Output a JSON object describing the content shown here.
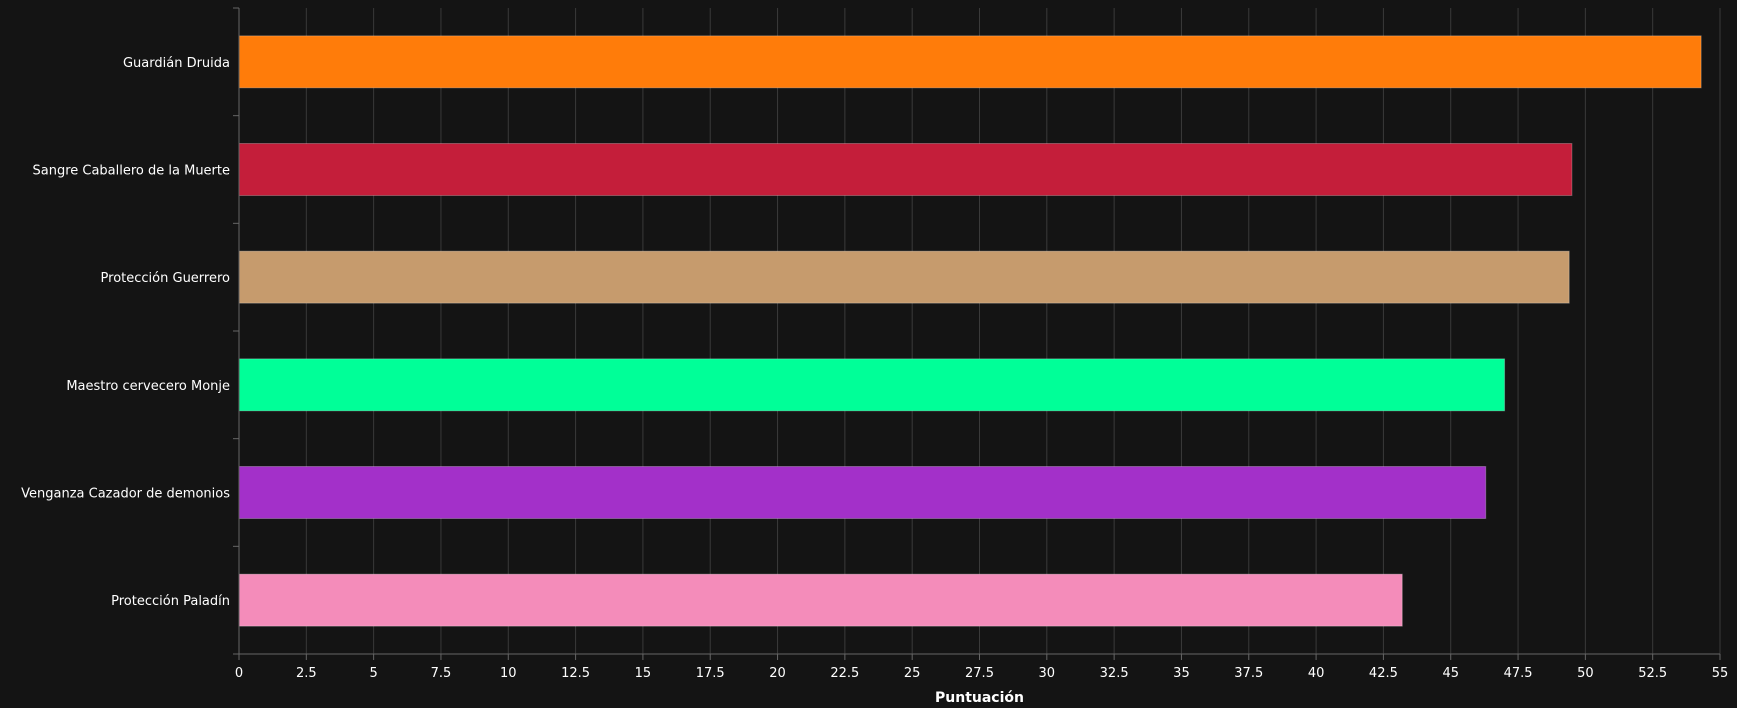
{
  "chart_data": {
    "type": "bar",
    "orientation": "horizontal",
    "categories": [
      "Guardián Druida",
      "Sangre Caballero de la Muerte",
      "Protección Guerrero",
      "Maestro cervecero Monje",
      "Venganza Cazador de demonios",
      "Protección Paladín"
    ],
    "values": [
      54.3,
      49.5,
      49.4,
      47.0,
      46.3,
      43.2
    ],
    "colors": [
      "#FF7C0A",
      "#C41E3A",
      "#C69B6D",
      "#00FF98",
      "#A330C9",
      "#F48CBA"
    ],
    "xlabel": "Puntuación",
    "ylabel": "",
    "xlim": [
      0,
      55
    ],
    "xticks": [
      "0",
      "2.5",
      "5",
      "7.5",
      "10",
      "12.5",
      "15",
      "17.5",
      "20",
      "22.5",
      "25",
      "27.5",
      "30",
      "32.5",
      "35",
      "37.5",
      "40",
      "42.5",
      "45",
      "47.5",
      "50",
      "52.5",
      "55"
    ],
    "grid": "vertical",
    "legend": "none",
    "background": "#141414",
    "grid_color": "#3a3a3a",
    "axis_color": "#666666",
    "text_color": "#ffffff"
  }
}
